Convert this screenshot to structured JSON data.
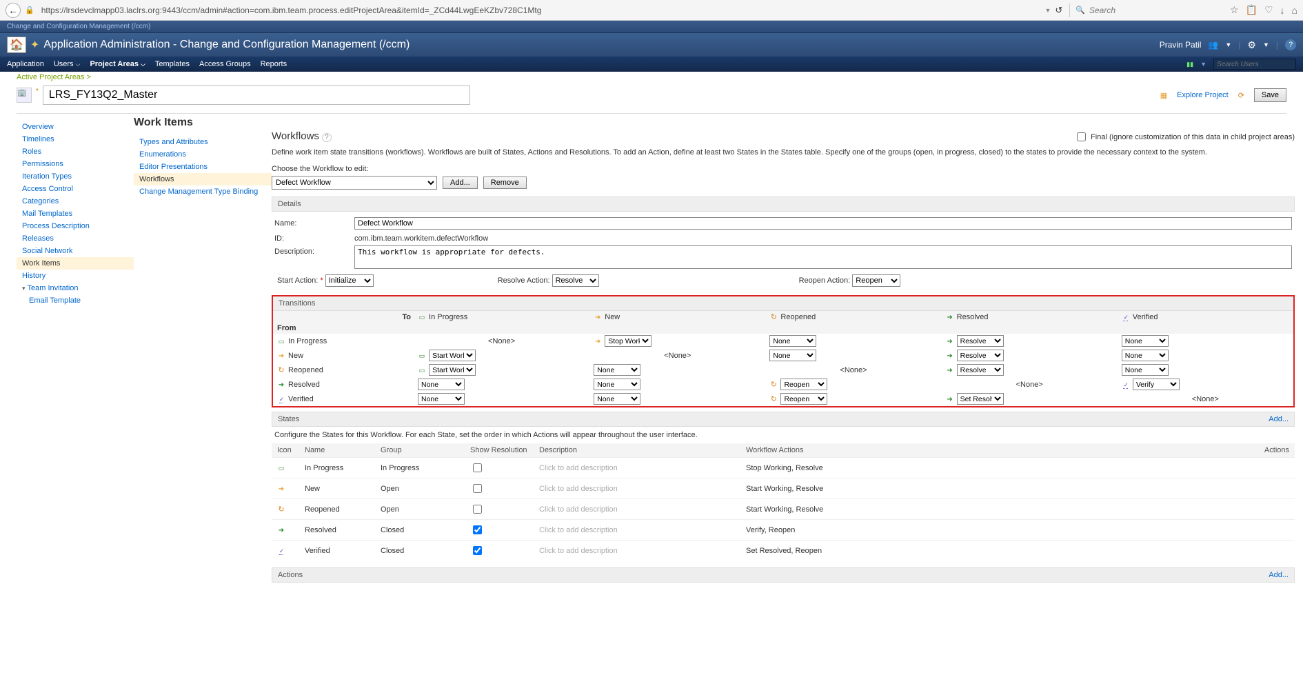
{
  "browser": {
    "url": "https://lrsdevclmapp03.laclrs.org:9443/ccm/admin#action=com.ibm.team.process.editProjectArea&itemId=_ZCd44LwgEeKZbv728C1Mtg",
    "search_placeholder": "Search"
  },
  "header": {
    "crumb": "Change and Configuration Management (/ccm)",
    "title": "Application Administration - Change and Configuration Management (/ccm)",
    "user": "Pravin Patil"
  },
  "nav": {
    "items": [
      "Application",
      "Users",
      "Project Areas",
      "Templates",
      "Access Groups",
      "Reports"
    ],
    "active": "Project Areas",
    "search_placeholder": "Search Users"
  },
  "breadcrumb": {
    "text": "Active Project Areas >"
  },
  "project": {
    "name": "LRS_FY13Q2_Master",
    "explore": "Explore Project",
    "save": "Save"
  },
  "leftnav": {
    "items": [
      "Overview",
      "Timelines",
      "Roles",
      "Permissions",
      "Iteration Types",
      "Access Control",
      "Categories",
      "Mail Templates",
      "Process Description",
      "Releases",
      "Social Network",
      "Work Items",
      "History"
    ],
    "selected": "Work Items",
    "team": "Team Invitation",
    "team_sub": "Email Template"
  },
  "subnav": {
    "heading": "Work Items",
    "items": [
      "Types and Attributes",
      "Enumerations",
      "Editor Presentations",
      "Workflows",
      "Change Management Type Binding"
    ],
    "selected": "Workflows"
  },
  "workflow": {
    "heading": "Workflows",
    "final_label": "Final (ignore customization of this data in child project areas)",
    "desc": "Define work item state transitions (workflows). Workflows are built of States, Actions and Resolutions. To add an Action, define at least two States in the States table. Specify one of the groups (open, in progress, closed) to the states to provide the necessary context to the system.",
    "choose_label": "Choose the Workflow to edit:",
    "selected": "Defect Workflow",
    "add": "Add...",
    "remove": "Remove"
  },
  "details": {
    "heading": "Details",
    "name_label": "Name:",
    "name_value": "Defect Workflow",
    "id_label": "ID:",
    "id_value": "com.ibm.team.workitem.defectWorkflow",
    "desc_label": "Description:",
    "desc_value": "This workflow is appropriate for defects.",
    "start_label": "Start Action:",
    "start_value": "Initialize",
    "resolve_label": "Resolve Action:",
    "resolve_value": "Resolve",
    "reopen_label": "Reopen Action:",
    "reopen_value": "Reopen"
  },
  "transitions": {
    "heading": "Transitions",
    "to_label": "To",
    "from_label": "From",
    "columns": [
      "In Progress",
      "New",
      "Reopened",
      "Resolved",
      "Verified"
    ],
    "rows": [
      {
        "state": "In Progress",
        "icon": "ic-inprog",
        "cells": [
          {
            "type": "none"
          },
          {
            "type": "sel",
            "icon": "ic-new",
            "val": "Stop Working"
          },
          {
            "type": "sel",
            "icon": "",
            "val": "None"
          },
          {
            "type": "sel",
            "icon": "ic-resolved",
            "val": "Resolve"
          },
          {
            "type": "sel",
            "icon": "",
            "val": "None"
          }
        ]
      },
      {
        "state": "New",
        "icon": "ic-new",
        "cells": [
          {
            "type": "sel",
            "icon": "ic-inprog",
            "val": "Start Working"
          },
          {
            "type": "none"
          },
          {
            "type": "sel",
            "icon": "",
            "val": "None"
          },
          {
            "type": "sel",
            "icon": "ic-resolved",
            "val": "Resolve"
          },
          {
            "type": "sel",
            "icon": "",
            "val": "None"
          }
        ]
      },
      {
        "state": "Reopened",
        "icon": "ic-reopen",
        "cells": [
          {
            "type": "sel",
            "icon": "ic-inprog",
            "val": "Start Working"
          },
          {
            "type": "sel",
            "icon": "",
            "val": "None"
          },
          {
            "type": "none"
          },
          {
            "type": "sel",
            "icon": "ic-resolved",
            "val": "Resolve"
          },
          {
            "type": "sel",
            "icon": "",
            "val": "None"
          }
        ]
      },
      {
        "state": "Resolved",
        "icon": "ic-resolved",
        "cells": [
          {
            "type": "sel",
            "icon": "",
            "val": "None"
          },
          {
            "type": "sel",
            "icon": "",
            "val": "None"
          },
          {
            "type": "sel",
            "icon": "ic-reopen",
            "val": "Reopen"
          },
          {
            "type": "none"
          },
          {
            "type": "sel",
            "icon": "ic-verified",
            "val": "Verify"
          }
        ]
      },
      {
        "state": "Verified",
        "icon": "ic-verified",
        "cells": [
          {
            "type": "sel",
            "icon": "",
            "val": "None"
          },
          {
            "type": "sel",
            "icon": "",
            "val": "None"
          },
          {
            "type": "sel",
            "icon": "ic-reopen",
            "val": "Reopen"
          },
          {
            "type": "sel",
            "icon": "ic-resolved",
            "val": "Set Resolved"
          },
          {
            "type": "none"
          }
        ]
      }
    ]
  },
  "states": {
    "heading": "States",
    "add": "Add...",
    "config_text": "Configure the States for this Workflow. For each State, set the order in which Actions will appear throughout the user interface.",
    "columns": [
      "Icon",
      "Name",
      "Group",
      "Show Resolution",
      "Description",
      "Workflow Actions",
      "Actions"
    ],
    "placeholder": "Click to add description",
    "rows": [
      {
        "icon": "ic-inprog",
        "name": "In Progress",
        "group": "In Progress",
        "show": false,
        "actions": "Stop Working, Resolve"
      },
      {
        "icon": "ic-new",
        "name": "New",
        "group": "Open",
        "show": false,
        "actions": "Start Working, Resolve"
      },
      {
        "icon": "ic-reopen",
        "name": "Reopened",
        "group": "Open",
        "show": false,
        "actions": "Start Working, Resolve"
      },
      {
        "icon": "ic-resolved",
        "name": "Resolved",
        "group": "Closed",
        "show": true,
        "actions": "Verify, Reopen"
      },
      {
        "icon": "ic-verified",
        "name": "Verified",
        "group": "Closed",
        "show": true,
        "actions": "Set Resolved, Reopen"
      }
    ]
  },
  "actions_section": {
    "heading": "Actions",
    "add": "Add..."
  }
}
